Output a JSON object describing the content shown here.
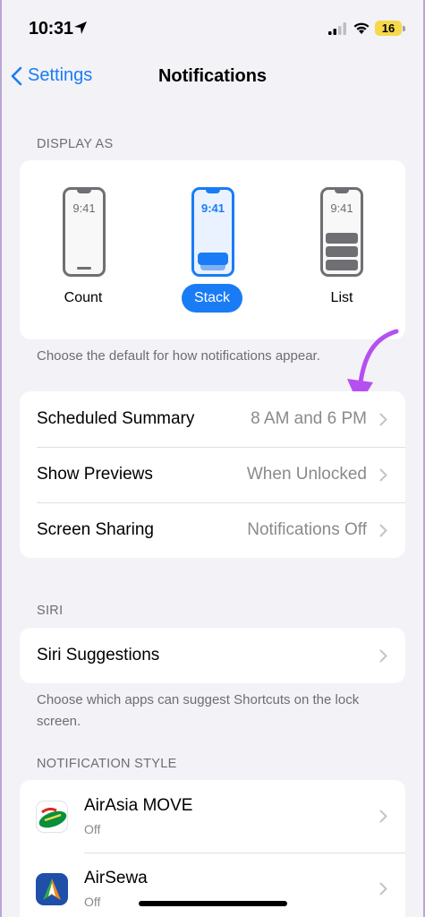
{
  "status": {
    "time": "10:31",
    "battery": "16"
  },
  "nav": {
    "back_label": "Settings",
    "title": "Notifications"
  },
  "display_as": {
    "header": "DISPLAY AS",
    "phone_time": "9:41",
    "options": [
      {
        "label": "Count",
        "selected": false
      },
      {
        "label": "Stack",
        "selected": true
      },
      {
        "label": "List",
        "selected": false
      }
    ],
    "footer": "Choose the default for how notifications appear."
  },
  "settings_rows": [
    {
      "label": "Scheduled Summary",
      "value": "8 AM and 6 PM"
    },
    {
      "label": "Show Previews",
      "value": "When Unlocked"
    },
    {
      "label": "Screen Sharing",
      "value": "Notifications Off"
    }
  ],
  "siri": {
    "header": "SIRI",
    "row_label": "Siri Suggestions",
    "footer": "Choose which apps can suggest Shortcuts on the lock screen."
  },
  "notification_style": {
    "header": "NOTIFICATION STYLE",
    "apps": [
      {
        "name": "AirAsia MOVE",
        "status": "Off"
      },
      {
        "name": "AirSewa",
        "status": "Off"
      }
    ]
  },
  "colors": {
    "accent": "#1a7cf5",
    "annotation": "#b54ff0",
    "background": "#f2f2f7"
  }
}
